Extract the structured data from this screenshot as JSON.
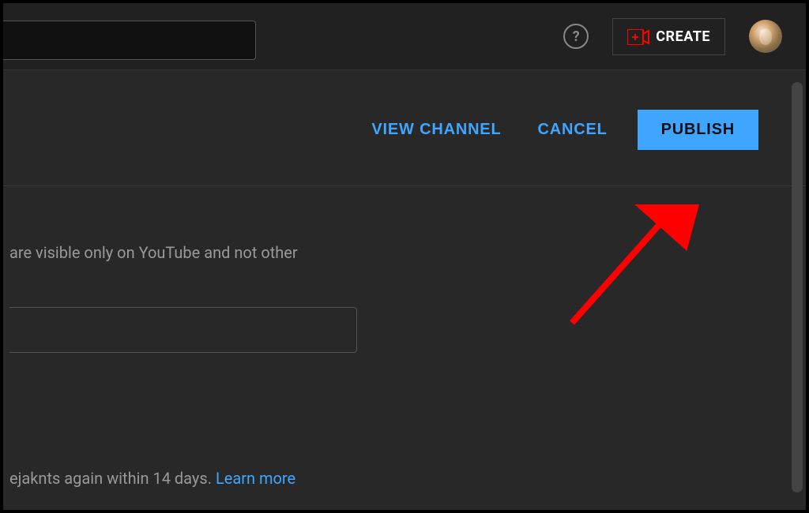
{
  "topbar": {
    "create_label": "CREATE"
  },
  "actions": {
    "view_channel": "VIEW CHANNEL",
    "cancel": "CANCEL",
    "publish": "PUBLISH"
  },
  "info": {
    "visibility_text": "are visible only on YouTube and not other"
  },
  "bottom": {
    "text_fragment": "ejaknts again within 14 days. ",
    "learn_more": "Learn more"
  }
}
